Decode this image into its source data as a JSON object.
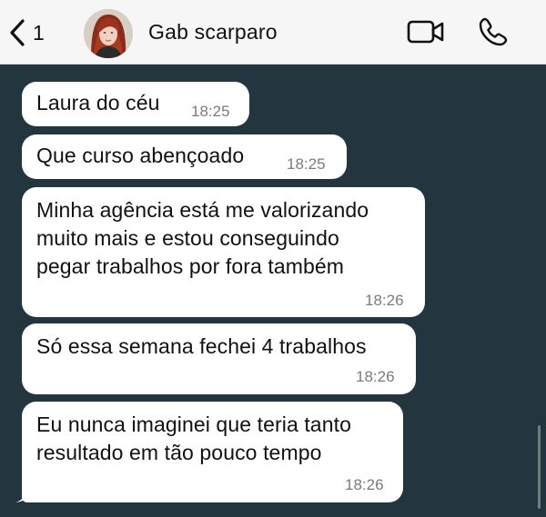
{
  "header": {
    "back_count": "1",
    "contact_name": "Gab scarparo"
  },
  "colors": {
    "header_bg": "#f6f6f6",
    "chat_bg": "#233640",
    "bubble_bg": "#ffffff",
    "time_text": "#7b7b7b"
  },
  "icons": {
    "back": "chevron-left-icon",
    "video": "video-camera-icon",
    "call": "phone-icon"
  },
  "messages": [
    {
      "text": "Laura do céu",
      "time": "18:25"
    },
    {
      "text": "Que curso abençoado",
      "time": "18:25"
    },
    {
      "text": "Minha agência está me valorizando\nmuito mais e estou conseguindo\npegar trabalhos por fora também",
      "time": "18:26"
    },
    {
      "text": "Só essa semana fechei 4 trabalhos",
      "time": "18:26"
    },
    {
      "text": "Eu nunca imaginei que teria tanto\nresultado em tão pouco tempo",
      "time": "18:26"
    }
  ]
}
